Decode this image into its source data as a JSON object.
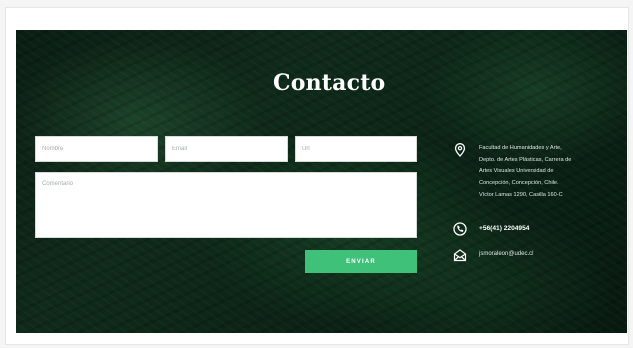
{
  "section": {
    "title": "Contacto"
  },
  "form": {
    "name_placeholder": "Nombre",
    "email_placeholder": "Email",
    "url_placeholder": "Url",
    "comment_placeholder": "Comentario",
    "submit_label": "ENVIAR"
  },
  "contact_info": {
    "address_lines": [
      "Facultad de Humanidades y Arte,",
      "Depto. de Artes Plásticas, Carrera de",
      "Artes Visuales Universidad de",
      "Concepción, Concepción, Chile.",
      "Víctor Lamas 1290, Casilla 160-C"
    ],
    "phone": "+56(41) 2204954",
    "email": "jsmoraleon@udec.cl",
    "icons": {
      "address": "location-pin-icon",
      "phone": "phone-icon",
      "email": "envelope-icon"
    }
  },
  "colors": {
    "background": "#0f2a1a",
    "accent": "#3fc17a",
    "title": "#ffffff"
  }
}
